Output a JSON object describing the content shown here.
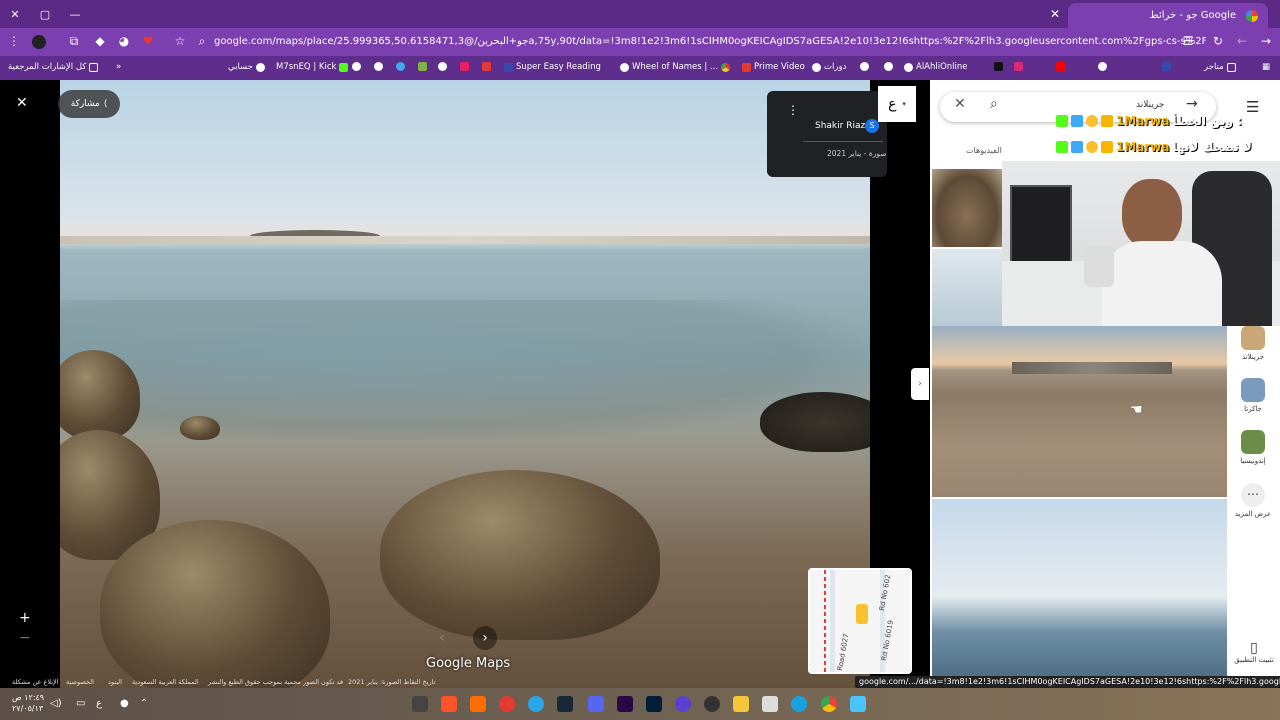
{
  "browser": {
    "tab_title": "جو - خرائط Google",
    "url": "google.com/maps/place/جو+البحرين/@25.999365,50.6158471,3a,75y,90t/data=!3m8!1e2!3m6!1sCIHM0ogKEICAgIDS7aGESA!2e10!3e12!6shttps:%2F%2Flh3.googleusercontent.com%2Fgps-cs-s%2FAG0ilSx5UTDtig...",
    "status_url": "google.com/.../data=!3m8!1e2!3m6!1sCIHM0ogKEICAgIDS7aGESA!2e10!3e12!6shttps:%2F%2Flh3.googleusercontent.com..."
  },
  "bookmarks": [
    "كل الإشارات المرجعية",
    "حسابي",
    "M7snEQ | Kick",
    "Super Easy Reading",
    "Wheel of Names | ...",
    "Prime Video",
    "دورات",
    "AlAhliOnline",
    "متاجر"
  ],
  "streetview": {
    "share_label": "مشاركة",
    "contributor": "Shakir Riaz",
    "contributor_initial": "S",
    "photo_date": "صورة - يناير 2021",
    "arabic_toggle": "ع",
    "logo": "Google Maps"
  },
  "minimap": {
    "roads": [
      "Rd No 602",
      "Rd No 6019",
      "Road 6027"
    ]
  },
  "sidebar": {
    "search_query": "جرينلاند",
    "videos_tab": "الفيديوهات",
    "categories": [
      {
        "label": "جرينلاند",
        "color": "#c9a777"
      },
      {
        "label": "جاكرتا",
        "color": "#7a9bbd"
      },
      {
        "label": "إندونيسيا",
        "color": "#6a8d4a"
      },
      {
        "label": "عرض المزيد",
        "color": "#eeeeee"
      }
    ],
    "install_app": "تثبيت التطبيق"
  },
  "chat": [
    {
      "user": "1Marwa",
      "text": "وين الخطأ :"
    },
    {
      "user": "1Marwa",
      "text": "لا تضحك لانها"
    }
  ],
  "footer": [
    "تاريخ التقاط الصورة: يناير 2021",
    "قد تكون الصور محمية بموجب حقوق الطبع والنشر",
    "المملكة العربية السعودية",
    "البنود",
    "الخصوصية",
    "الإبلاغ عن مشكلة"
  ],
  "taskbar": {
    "time": "١٢:٤٩ ص",
    "date": "٢٧/٠٥/١٣",
    "lang": "ع"
  }
}
